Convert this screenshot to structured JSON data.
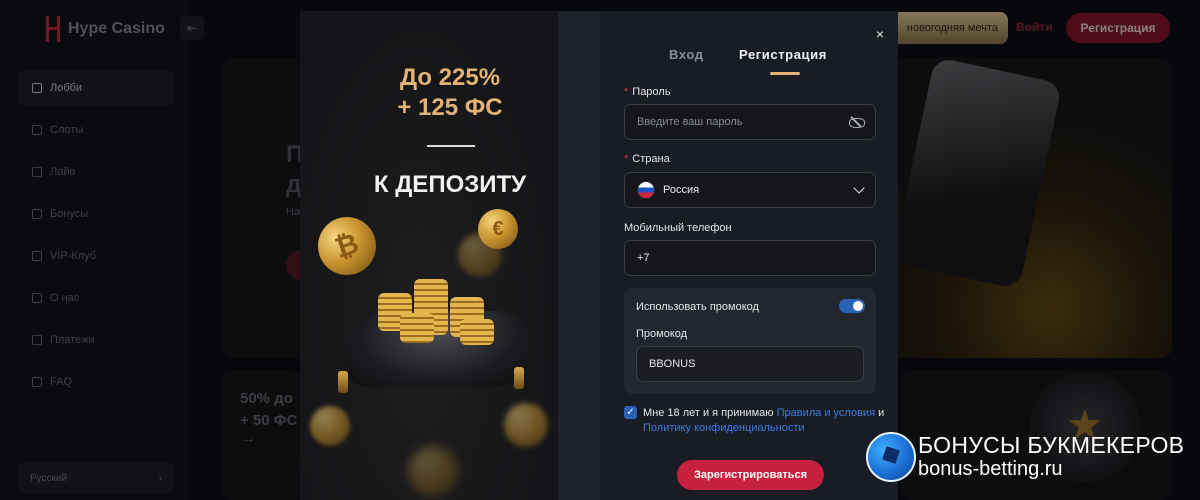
{
  "app": {
    "brand": "Hype Casino"
  },
  "sidebar": {
    "items": [
      {
        "label": "Лобби",
        "icon": "home-icon",
        "active": true
      },
      {
        "label": "Слоты",
        "icon": "grid-icon"
      },
      {
        "label": "Лайв",
        "icon": "spade-icon"
      },
      {
        "label": "Бонусы",
        "icon": "gift-icon"
      },
      {
        "label": "VIP-Клуб",
        "icon": "diamond-icon"
      },
      {
        "label": "О нас",
        "icon": "rocket-icon"
      },
      {
        "label": "Платежи",
        "icon": "wallet-icon"
      },
      {
        "label": "FAQ",
        "icon": "info-icon"
      }
    ],
    "language": "Русский"
  },
  "header": {
    "promo_label": "новогодняя мечта",
    "login_label": "Войти",
    "register_label": "Регистрация"
  },
  "background": {
    "hero_line1": "П",
    "hero_line2": "д",
    "hero_small": "На",
    "card_line1": "50% до",
    "card_line2": "+ 50 ФС",
    "card_arrow": "→"
  },
  "promo": {
    "amount_line1": "До 225%",
    "amount_line2": "+ 125 ФС",
    "deposit": "К ДЕПОЗИТУ",
    "coin_bitcoin": "₿",
    "coin_euro": "€"
  },
  "modal": {
    "close": "×",
    "tabs": {
      "login": "Вход",
      "register": "Регистрация"
    },
    "password": {
      "required_mark": "*",
      "label": "Пароль",
      "placeholder": "Введите ваш пароль"
    },
    "country": {
      "required_mark": "*",
      "label": "Страна",
      "value": "Россия"
    },
    "phone": {
      "label": "Мобильный телефон",
      "value": "+7"
    },
    "promo_code": {
      "toggle_label": "Использовать промокод",
      "toggle_on": true,
      "label": "Промокод",
      "value": "BBONUS"
    },
    "terms": {
      "prefix": "Мне 18 лет и я принимаю",
      "rules_link": "Правила и условия",
      "conjunction": "и",
      "privacy_link": "Политику конфиденциальности"
    },
    "submit_label": "Зарегистрироваться"
  },
  "watermark": {
    "line1": "БОНУСЫ БУКМЕКЕРОВ",
    "line2": "bonus-betting.ru"
  },
  "colors": {
    "accent_red": "#c8213f",
    "gold": "#e4b274",
    "link_blue": "#3b7be0",
    "toggle_blue": "#2a62b8"
  }
}
